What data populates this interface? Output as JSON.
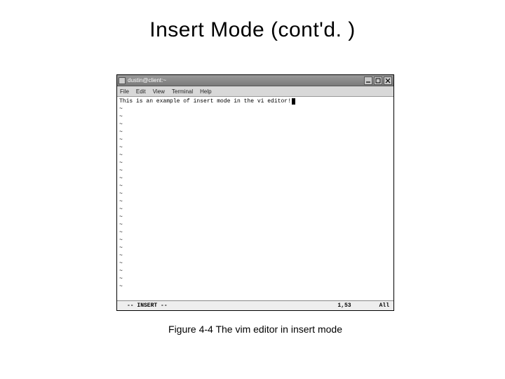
{
  "title": "Insert Mode (cont'd. )",
  "window": {
    "titlebar_text": "dustin@client:~",
    "menus": [
      "File",
      "Edit",
      "View",
      "Terminal",
      "Help"
    ],
    "editor_text": "This is an example of insert mode in the vi editor!",
    "tilde_count": 24,
    "status": {
      "mode": "INSERT",
      "position": "1,53",
      "scroll": "All"
    }
  },
  "caption": "Figure 4-4 The vim editor in insert mode",
  "icons": {
    "app": "terminal-icon",
    "minimize": "minimize-icon",
    "maximize": "maximize-icon",
    "close": "close-icon"
  }
}
